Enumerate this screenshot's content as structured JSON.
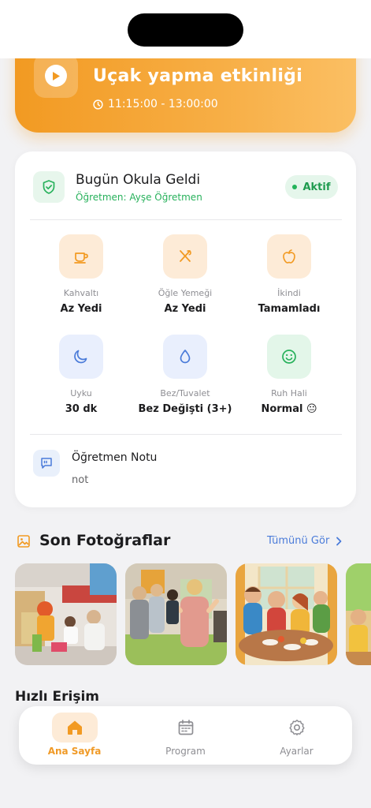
{
  "activity": {
    "title": "Uçak yapma etkinliği",
    "time": "11:15:00 - 13:00:00",
    "icon": "play-icon",
    "accent": "#F29A22"
  },
  "attendance": {
    "title": "Bugün Okula Geldi",
    "teacher": "Öğretmen: Ayşe Öğretmen",
    "badge": "Aktif",
    "icon": "shield-check-icon",
    "accent": "#27B15B"
  },
  "metrics": [
    {
      "label": "Kahvaltı",
      "value": "Az Yedi",
      "icon": "coffee-cup-icon"
    },
    {
      "label": "Öğle Yemeği",
      "value": "Az Yedi",
      "icon": "utensils-icon"
    },
    {
      "label": "İkindi",
      "value": "Tamamladı",
      "icon": "apple-icon"
    },
    {
      "label": "Uyku",
      "value": "30 dk",
      "icon": "moon-icon"
    },
    {
      "label": "Bez/Tuvalet",
      "value": "Bez Değişti (3+)",
      "icon": "droplet-icon"
    },
    {
      "label": "Ruh Hali",
      "value": "Normal 😐",
      "icon": "smiley-icon"
    }
  ],
  "note": {
    "title": "Öğretmen Notu",
    "text": "not",
    "icon": "message-quote-icon"
  },
  "photos": {
    "title": "Son Fotoğraflar",
    "see_all": "Tümünü Gör",
    "icon": "image-icon",
    "link_color": "#4A7BD9"
  },
  "quick_access": {
    "title": "Hızlı Erişim"
  },
  "tabs": [
    {
      "label": "Ana Sayfa",
      "icon": "home-icon",
      "active": true
    },
    {
      "label": "Program",
      "icon": "calendar-icon",
      "active": false
    },
    {
      "label": "Ayarlar",
      "icon": "gear-icon",
      "active": false
    }
  ]
}
